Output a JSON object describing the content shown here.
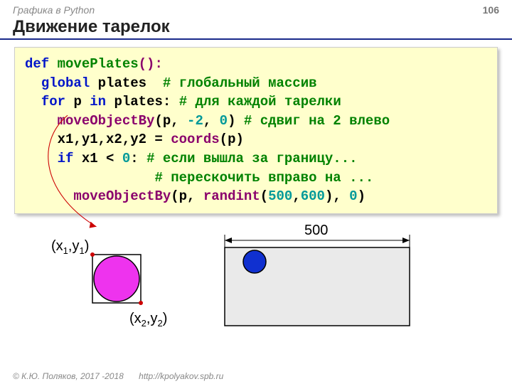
{
  "header": {
    "left": "Графика в Python",
    "page": "106"
  },
  "title": "Движение тарелок",
  "code": {
    "def": "def",
    "fn": "movePlates",
    "parens": "():",
    "global": "global",
    "plates": "plates",
    "c1": "# глобальный массив",
    "for": "for",
    "p": "p",
    "in": "in",
    "plates2": "plates:",
    "c2": "# для каждой тарелки",
    "mob": "moveObjectBy",
    "args1a": "(p, ",
    "n2": "-2",
    "comma": ", ",
    "z0": "0",
    "args1b": ")",
    "c3": "# сдвиг на 2 влево",
    "coords_line": "x1,y1,x2,y2 = ",
    "coords_fn": "coords",
    "coords_arg": "(p)",
    "if": "if",
    "cond": " x1 < ",
    "z0b": "0",
    "colon": ":",
    "c4": "# если вышла за границу...",
    "c5": "# перескочить вправо на ...",
    "mob2": "moveObjectBy",
    "args2a": "(p, ",
    "rand": "randint",
    "rp_open": "(",
    "n500": "500",
    "comma2": ",",
    "n600": "600",
    "rp_close": ")",
    "comma3": ", ",
    "z0c": "0",
    "args2b": ")"
  },
  "labels": {
    "x1y1_a": "(x",
    "x1y1_s1": "1",
    "x1y1_b": ",y",
    "x1y1_s2": "1",
    "x1y1_c": ")",
    "x2y2_a": "(x",
    "x2y2_s1": "2",
    "x2y2_b": ",y",
    "x2y2_s2": "2",
    "x2y2_c": ")",
    "width": "500"
  },
  "footer": {
    "copy": "© К.Ю. Поляков, 2017 -2018",
    "url": "http://kpolyakov.spb.ru"
  }
}
